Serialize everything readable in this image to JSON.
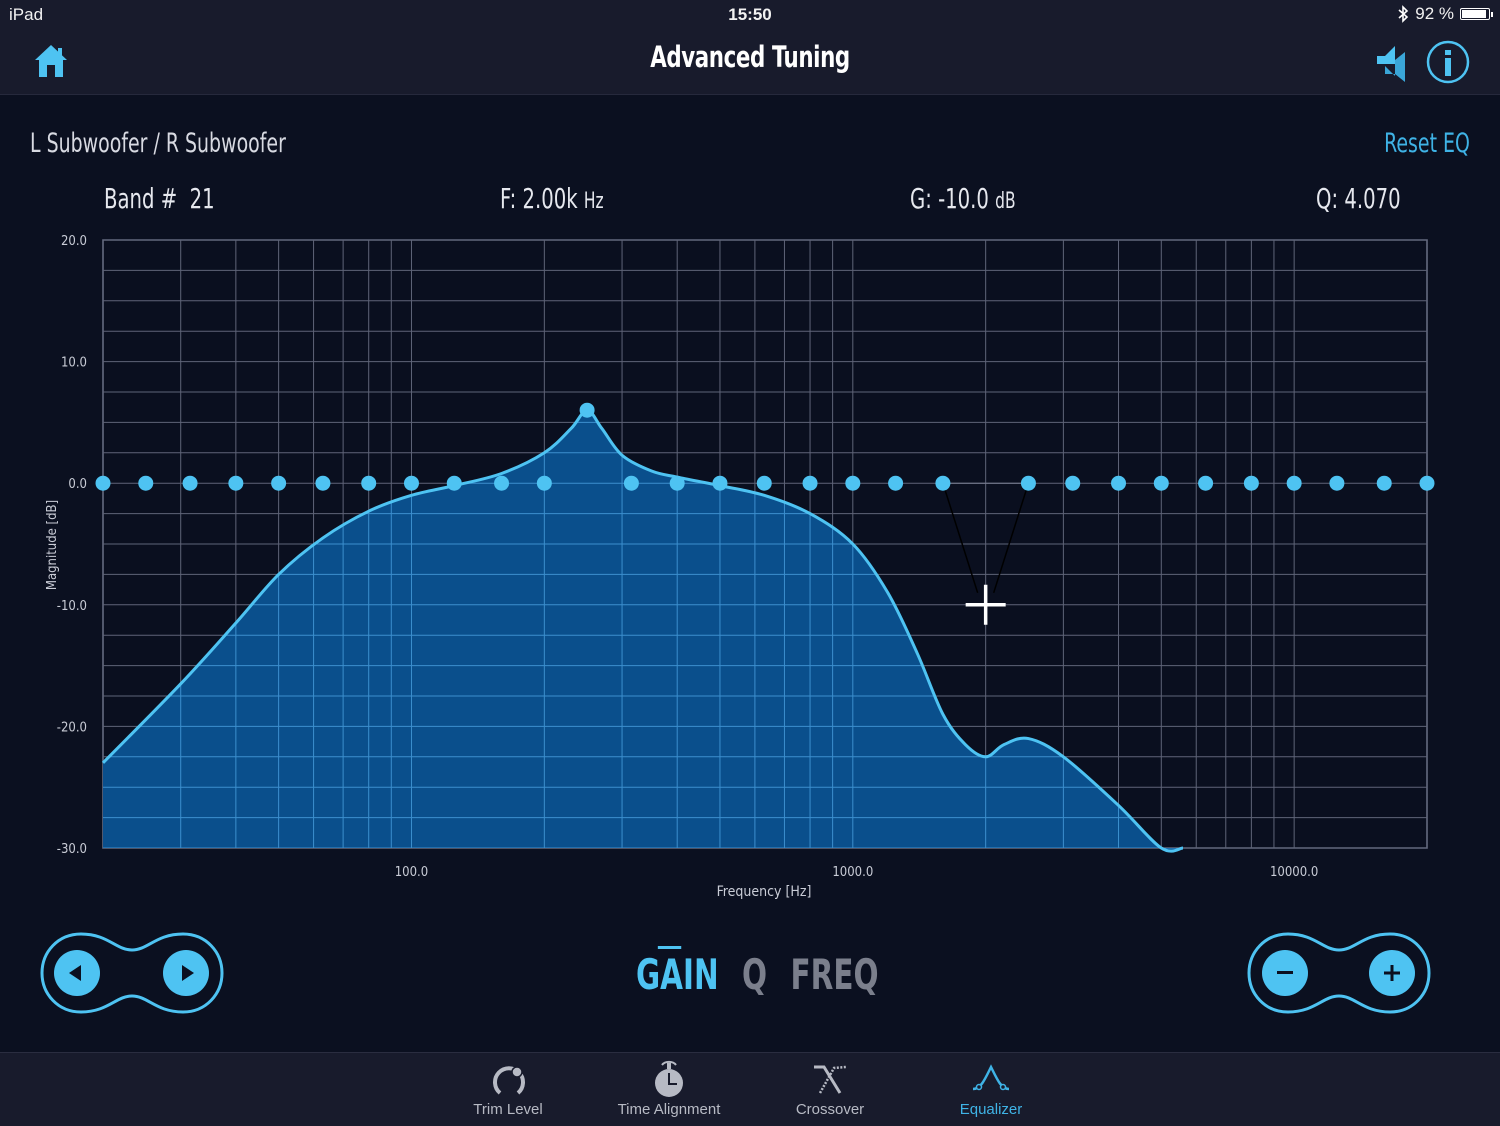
{
  "status_bar": {
    "carrier": "iPad",
    "time": "15:50",
    "bluetooth_icon": "bluetooth-icon",
    "battery_percent_label": "92 %",
    "battery_level": 0.92
  },
  "nav": {
    "title": "Advanced Tuning",
    "home_icon": "home-icon",
    "speaker_icon": "speaker-mute-icon",
    "info_icon": "info-icon"
  },
  "eq": {
    "channel": "L Subwoofer / R Subwoofer",
    "reset_label": "Reset EQ",
    "band_label": "Band #",
    "band_value": "21",
    "freq_label": "F:",
    "freq_value": "2.00k",
    "freq_unit": "Hz",
    "gain_label": "G:",
    "gain_value": "-10.0",
    "gain_unit": "dB",
    "q_label": "Q:",
    "q_value": "4.070"
  },
  "chart_data": {
    "type": "line",
    "title": "",
    "xlabel": "Frequency [Hz]",
    "ylabel": "Magnitude [dB]",
    "x_scale": "log",
    "xlim": [
      20,
      20000
    ],
    "ylim": [
      -30,
      20
    ],
    "grid": true,
    "x_tick_labels": [
      "100.0",
      "1000.0",
      "10000.0"
    ],
    "x_ticks": [
      100,
      1000,
      10000
    ],
    "y_tick_labels": [
      "20.0",
      "10.0",
      "0.0",
      "-10.0",
      "-20.0",
      "-30.0"
    ],
    "y_ticks": [
      20,
      10,
      0,
      -10,
      -20,
      -30
    ],
    "band_points": {
      "freqs": [
        20,
        25,
        31.5,
        40,
        50,
        63,
        80,
        100,
        125,
        160,
        200,
        250,
        315,
        400,
        500,
        630,
        800,
        1000,
        1250,
        1600,
        2000,
        2500,
        3150,
        4000,
        5000,
        6300,
        8000,
        10000,
        12500,
        16000,
        20000
      ],
      "gains": [
        0,
        0,
        0,
        0,
        0,
        0,
        0,
        0,
        0,
        0,
        0,
        6,
        0,
        0,
        0,
        0,
        0,
        0,
        0,
        0,
        -10,
        0,
        0,
        0,
        0,
        0,
        0,
        0,
        0,
        0,
        0
      ],
      "selected_band": 21
    },
    "response_curve": {
      "x": [
        20,
        30,
        40,
        50,
        63,
        80,
        100,
        125,
        160,
        200,
        230,
        250,
        270,
        300,
        350,
        400,
        500,
        630,
        800,
        1000,
        1200,
        1400,
        1600,
        1800,
        2000,
        2200,
        2500,
        3000,
        4000,
        5000,
        5600
      ],
      "y": [
        -23,
        -16.5,
        -11.5,
        -7.5,
        -4.5,
        -2.3,
        -1,
        -0.2,
        0.8,
        2.5,
        4.5,
        6,
        4.5,
        2.3,
        1,
        0.5,
        -0.2,
        -1,
        -2.5,
        -5,
        -9,
        -14,
        -19,
        -21.5,
        -22.5,
        -21.5,
        -21,
        -22.5,
        -26.5,
        -30,
        -30
      ]
    }
  },
  "mode_selector": {
    "options": [
      "GAIN",
      "Q",
      "FREQ"
    ],
    "active": "GAIN"
  },
  "band_nav": {
    "prev_icon": "triangle-left-icon",
    "next_icon": "triangle-right-icon"
  },
  "value_stepper": {
    "minus_icon": "minus-icon",
    "plus_icon": "plus-icon"
  },
  "tab_bar": {
    "tabs": [
      {
        "label": "Trim Level",
        "icon": "trim-knob-icon"
      },
      {
        "label": "Time Alignment",
        "icon": "stopwatch-icon"
      },
      {
        "label": "Crossover",
        "icon": "crossover-icon"
      },
      {
        "label": "Equalizer",
        "icon": "equalizer-icon"
      }
    ],
    "active": "Equalizer"
  },
  "colors": {
    "accent": "#4ec3f2",
    "fill": "#0a4f8c",
    "background": "#0b1020",
    "bar": "#181b2c"
  }
}
